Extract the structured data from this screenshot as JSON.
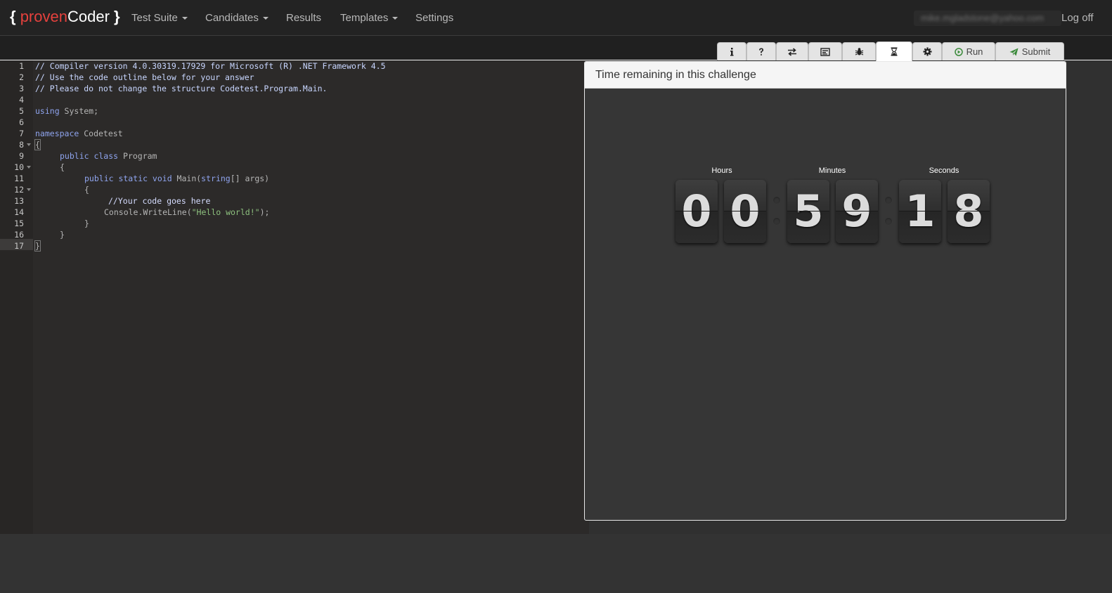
{
  "brand": {
    "open_brace": "{",
    "proven": "proven",
    "coder": "Coder",
    "close_brace": "}"
  },
  "nav": {
    "items": [
      {
        "label": "Test Suite",
        "dropdown": true
      },
      {
        "label": "Candidates",
        "dropdown": true
      },
      {
        "label": "Results",
        "dropdown": false
      },
      {
        "label": "Templates",
        "dropdown": true
      },
      {
        "label": "Settings",
        "dropdown": false
      }
    ],
    "user_email": "mike.mgladstone@yahoo.com",
    "logoff_label": "Log off"
  },
  "toolbar": {
    "tabs": [
      {
        "icon": "info-icon"
      },
      {
        "icon": "question-icon"
      },
      {
        "icon": "swap-icon"
      },
      {
        "icon": "console-icon"
      },
      {
        "icon": "bug-icon"
      },
      {
        "icon": "hourglass-icon",
        "active": true
      },
      {
        "icon": "gear-icon"
      }
    ],
    "run_label": "Run",
    "submit_label": "Submit"
  },
  "editor": {
    "line_numbers": [
      "1",
      "2",
      "3",
      "4",
      "5",
      "6",
      "7",
      "8",
      "9",
      "10",
      "11",
      "12",
      "13",
      "14",
      "15",
      "16",
      "17"
    ],
    "lines": {
      "l1": "// Compiler version 4.0.30319.17929 for Microsoft (R) .NET Framework 4.5",
      "l2": "// Use the code outline below for your answer",
      "l3": "// Please do not change the structure Codetest.Program.Main.",
      "l5_kw": "using",
      "l5_rest": " System;",
      "l7_kw": "namespace",
      "l7_rest": " Codetest",
      "l8": "{",
      "l9_kw": "public class",
      "l9_rest": " Program",
      "l10": "{",
      "l11_kw": "public static void",
      "l11_mid": " Main(",
      "l11_type": "string",
      "l11_end": "[] args)",
      "l12": "{",
      "l13": "//Your code goes here",
      "l14_pre": "Console.WriteLine(",
      "l14_str": "\"Hello world!\"",
      "l14_end": ");",
      "l15": "}",
      "l16": "}",
      "l17": "}"
    }
  },
  "timer": {
    "title": "Time remaining in this challenge",
    "hours_label": "Hours",
    "minutes_label": "Minutes",
    "seconds_label": "Seconds",
    "h1": "0",
    "h2": "0",
    "m1": "5",
    "m2": "9",
    "s1": "1",
    "s2": "8"
  }
}
